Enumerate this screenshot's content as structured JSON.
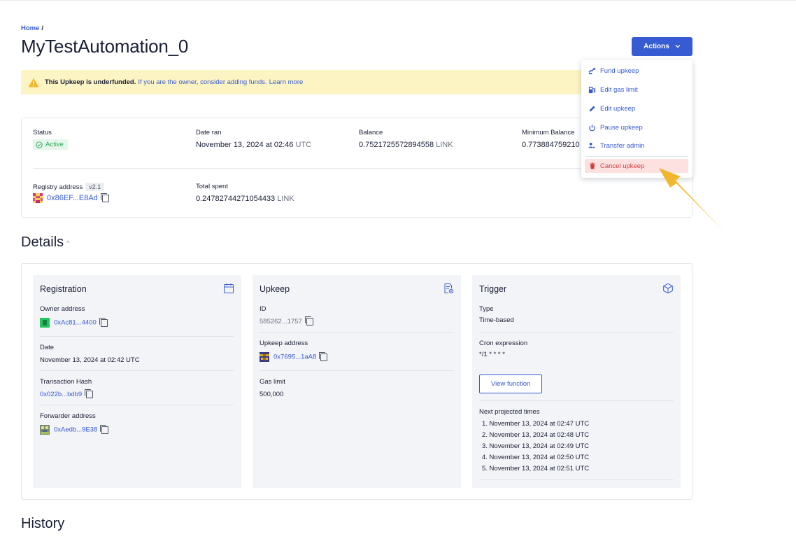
{
  "breadcrumb": {
    "home": "Home",
    "separator": "/"
  },
  "page": {
    "title": "MyTestAutomation_0",
    "actions_label": "Actions"
  },
  "banner": {
    "strong": "This Upkeep is underfunded.",
    "rest": "If you are the owner, consider adding funds.",
    "link": "Learn more",
    "color": "#fdf4c4"
  },
  "summary": {
    "status_label": "Status",
    "status_value": "Active",
    "date_ran_label": "Date ran",
    "date_ran_value": "November 13, 2024 at 02:46",
    "date_ran_tz": "UTC",
    "balance_label": "Balance",
    "balance_value": "0.7521725572894558",
    "balance_unit": "LINK",
    "min_balance_label": "Minimum Balance",
    "min_balance_value": "0.773884759210",
    "registry_label": "Registry address",
    "registry_version": "v2.1",
    "registry_address": "0x86EF...E8Ad",
    "total_spent_label": "Total spent",
    "total_spent_value": "0.24782744271054433",
    "total_spent_unit": "LINK"
  },
  "details": {
    "heading": "Details",
    "registration": {
      "title": "Registration",
      "owner_label": "Owner address",
      "owner_value": "0xAc81...4400",
      "date_label": "Date",
      "date_value": "November 13, 2024 at 02:42 UTC",
      "tx_label": "Transaction Hash",
      "tx_value": "0x022b...bdb9",
      "forwarder_label": "Forwarder address",
      "forwarder_value": "0xAedb...9E38"
    },
    "upkeep": {
      "title": "Upkeep",
      "id_label": "ID",
      "id_value": "585262...1757",
      "address_label": "Upkeep address",
      "address_value": "0x7695...1aA8",
      "gas_label": "Gas limit",
      "gas_value": "500,000"
    },
    "trigger": {
      "title": "Trigger",
      "type_label": "Type",
      "type_value": "Time-based",
      "cron_label": "Cron expression",
      "cron_value": "*/1 * * * *",
      "view_function": "View function",
      "next_label": "Next projected times",
      "times": [
        "1. November 13, 2024 at 02:47 UTC",
        "2. November 13, 2024 at 02:48 UTC",
        "3. November 13, 2024 at 02:49 UTC",
        "4. November 13, 2024 at 02:50 UTC",
        "5. November 13, 2024 at 02:51 UTC"
      ]
    }
  },
  "history": {
    "heading": "History"
  },
  "menu": {
    "items": [
      {
        "label": "Fund upkeep",
        "icon": "fund-icon"
      },
      {
        "label": "Edit gas limit",
        "icon": "gas-pump-icon"
      },
      {
        "label": "Edit upkeep",
        "icon": "pencil-icon"
      },
      {
        "label": "Pause upkeep",
        "icon": "power-icon"
      },
      {
        "label": "Transfer admin",
        "icon": "transfer-user-icon"
      }
    ],
    "cancel": {
      "label": "Cancel upkeep",
      "icon": "trash-icon"
    }
  },
  "colors": {
    "accent": "#375bd2",
    "danger": "#d43a3a",
    "success": "#2fa55a",
    "annotation_arrow": "#f0bf3a"
  }
}
